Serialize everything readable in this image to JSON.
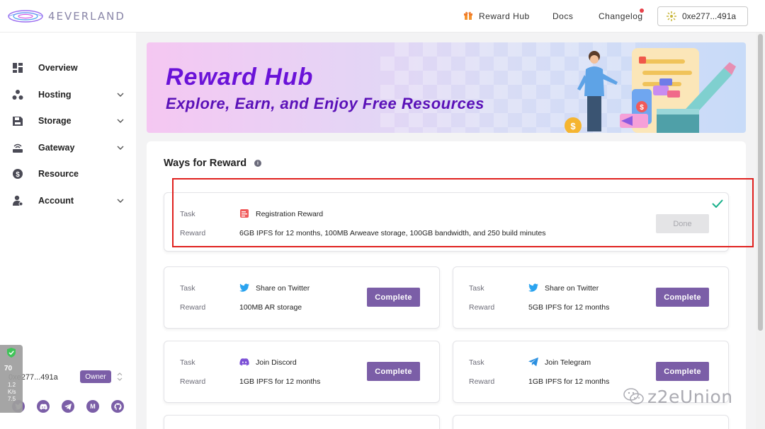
{
  "header": {
    "logo_text": "4EVERLAND",
    "nav": {
      "reward_hub": "Reward Hub",
      "docs": "Docs",
      "changelog": "Changelog"
    },
    "wallet_address": "0xe277...491a"
  },
  "sidebar": {
    "items": [
      {
        "label": "Overview",
        "icon": "grid-icon",
        "expandable": false
      },
      {
        "label": "Hosting",
        "icon": "nodes-icon",
        "expandable": true
      },
      {
        "label": "Storage",
        "icon": "disk-icon",
        "expandable": true
      },
      {
        "label": "Gateway",
        "icon": "router-icon",
        "expandable": true
      },
      {
        "label": "Resource",
        "icon": "dollar-icon",
        "expandable": false
      },
      {
        "label": "Account",
        "icon": "user-gear-icon",
        "expandable": true
      }
    ],
    "user": {
      "address": "0xe277...491a",
      "role": "Owner"
    },
    "socials": [
      "twitter-icon",
      "discord-icon",
      "telegram-icon",
      "medium-icon",
      "github-icon"
    ]
  },
  "perf_widget": {
    "score": "70",
    "line1": "1.2",
    "line2": "K/s",
    "line3": "7.5"
  },
  "banner": {
    "title": "Reward Hub",
    "subtitle": "Explore, Earn, and Enjoy Free Resources"
  },
  "main": {
    "section_title": "Ways for Reward",
    "task_label": "Task",
    "reward_label": "Reward",
    "cards": [
      {
        "task": "Registration Reward",
        "reward": "6GB IPFS for 12 months, 100MB Arweave storage, 100GB bandwidth, and 250 build minutes",
        "button": "Done",
        "status": "done",
        "icon": "registration-icon"
      },
      {
        "task": "Share on Twitter",
        "reward": "100MB AR storage",
        "button": "Complete",
        "status": "open",
        "icon": "twitter-icon"
      },
      {
        "task": "Share on Twitter",
        "reward": "5GB IPFS for 12 months",
        "button": "Complete",
        "status": "open",
        "icon": "twitter-icon"
      },
      {
        "task": "Join Discord",
        "reward": "1GB IPFS for 12 months",
        "button": "Complete",
        "status": "open",
        "icon": "discord-icon"
      },
      {
        "task": "Join Telegram",
        "reward": "1GB IPFS for 12 months",
        "button": "Complete",
        "status": "open",
        "icon": "telegram-icon"
      }
    ]
  },
  "watermark": "z2eUnion",
  "colors": {
    "accent": "#7b5ea7",
    "banner_title": "#6a12d8",
    "highlight": "#e0201e",
    "check": "#17b08a"
  }
}
